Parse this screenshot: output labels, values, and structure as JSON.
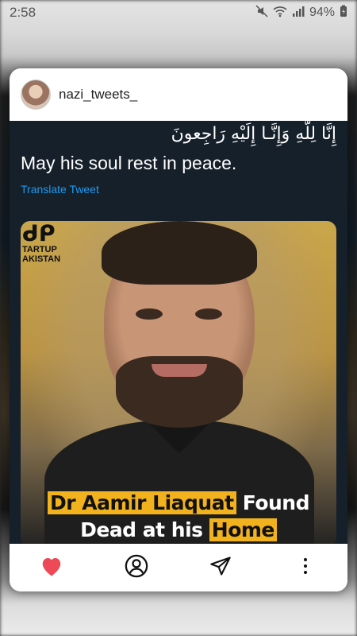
{
  "status_bar": {
    "time": "2:58",
    "battery": "94%",
    "icons": [
      "mute-icon",
      "wifi-icon",
      "signal-icon",
      "battery-charging-icon"
    ]
  },
  "header": {
    "username": "nazi_tweets_"
  },
  "tweet": {
    "arabic_text": "إِنَّا لِلّهِ وَإِنَّـا إِلَيْهِ رَاجِعونَ",
    "text": "May his soul rest in peace.",
    "translate_label": "Translate Tweet"
  },
  "image": {
    "logo_text_line1": "TARTUP",
    "logo_text_line2": "AKISTAN",
    "caption_highlight_1": "Dr Aamir Liaquat",
    "caption_plain_1": " Found",
    "caption_plain_2": "Dead at his ",
    "caption_highlight_2": "Home"
  },
  "actions": [
    "like-icon",
    "profile-icon",
    "share-icon",
    "more-options-icon"
  ],
  "colors": {
    "tweet_bg": "#15202b",
    "link": "#1d9bf0",
    "highlight": "#f2b21e",
    "like": "#ed4956"
  }
}
